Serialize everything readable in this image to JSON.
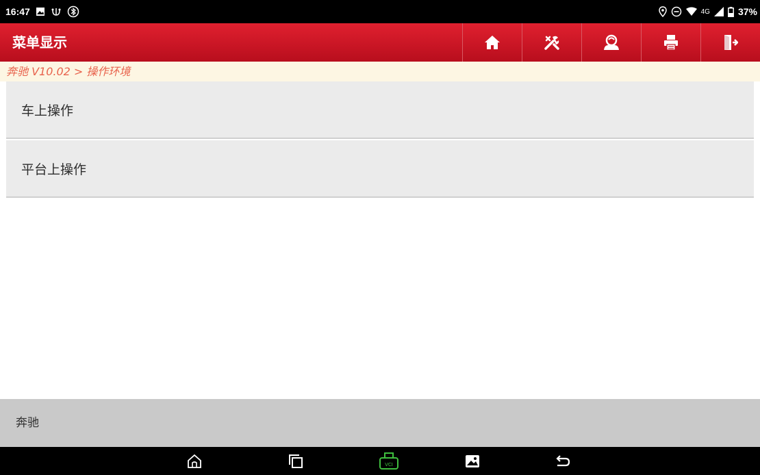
{
  "status_bar": {
    "time": "16:47",
    "left_icons": [
      "image-icon",
      "usb-debug-icon",
      "bluetooth-icon"
    ],
    "right_icons": [
      "location-icon",
      "do-not-disturb-icon",
      "wifi-icon",
      "signal-icon",
      "battery-icon"
    ],
    "network": "4G",
    "battery": "37%"
  },
  "header": {
    "title": "菜单显示",
    "buttons": [
      "home-icon",
      "tools-icon",
      "user-icon",
      "print-icon",
      "exit-icon"
    ]
  },
  "breadcrumb": {
    "text": "奔驰 V10.02 > 操作环境"
  },
  "menu": {
    "items": [
      {
        "label": "车上操作"
      },
      {
        "label": "平台上操作"
      }
    ]
  },
  "footer": {
    "label": "奔驰"
  },
  "nav_bar": {
    "buttons": [
      "nav-home-icon",
      "recent-apps-icon",
      "vci-icon",
      "gallery-icon",
      "back-icon"
    ],
    "vci_label": "VCI"
  },
  "colors": {
    "header_top": "#e0202f",
    "header_bottom": "#b80e1d",
    "breadcrumb_text": "#e8634d",
    "breadcrumb_bg": "#fdf6e3",
    "menu_bg": "#ebebeb",
    "footer_bg": "#c9c9c9",
    "vci_green": "#3fbf3f"
  }
}
